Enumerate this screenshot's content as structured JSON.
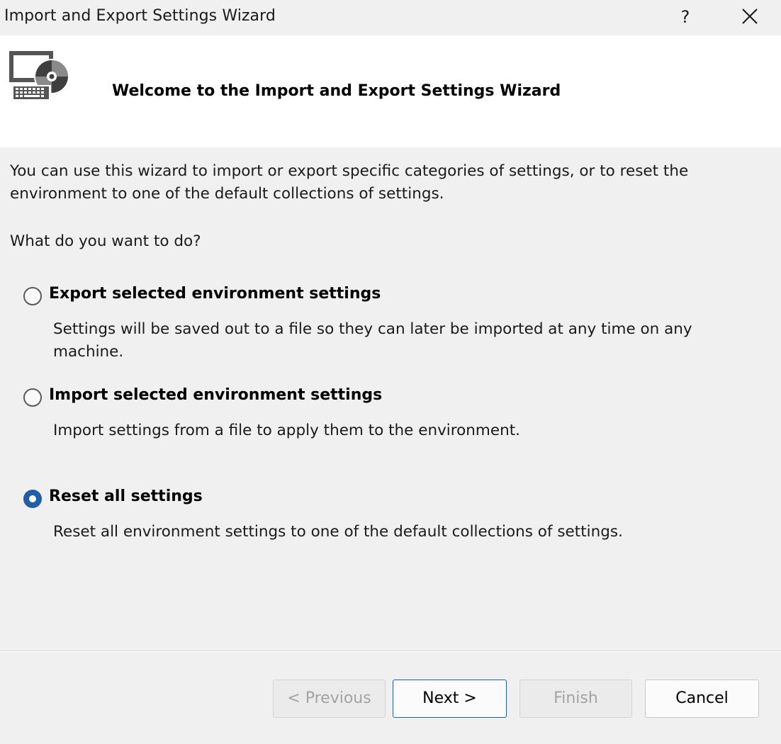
{
  "window": {
    "title": "Import and Export Settings Wizard",
    "help_label": "?",
    "close_icon": "close-icon"
  },
  "header": {
    "icon": "settings-wizard-icon",
    "title": "Welcome to the Import and Export Settings Wizard"
  },
  "content": {
    "intro": "You can use this wizard to import or export specific categories of settings, or to reset the environment to one of the default collections of settings.",
    "question": "What do you want to do?",
    "options": [
      {
        "label": "Export selected environment settings",
        "description": "Settings will be saved out to a file so they can later be imported at any time on any machine.",
        "selected": false
      },
      {
        "label": "Import selected environment settings",
        "description": "Import settings from a file to apply them to the environment.",
        "selected": false
      },
      {
        "label": "Reset all settings",
        "description": "Reset all environment settings to one of the default collections of settings.",
        "selected": true
      }
    ]
  },
  "footer": {
    "previous_label": "< Previous",
    "next_label": "Next >",
    "finish_label": "Finish",
    "cancel_label": "Cancel"
  },
  "colors": {
    "accent": "#1f5ea8",
    "background": "#f0f0f0",
    "header_background": "#ffffff",
    "disabled_text": "#a3a3a3"
  }
}
